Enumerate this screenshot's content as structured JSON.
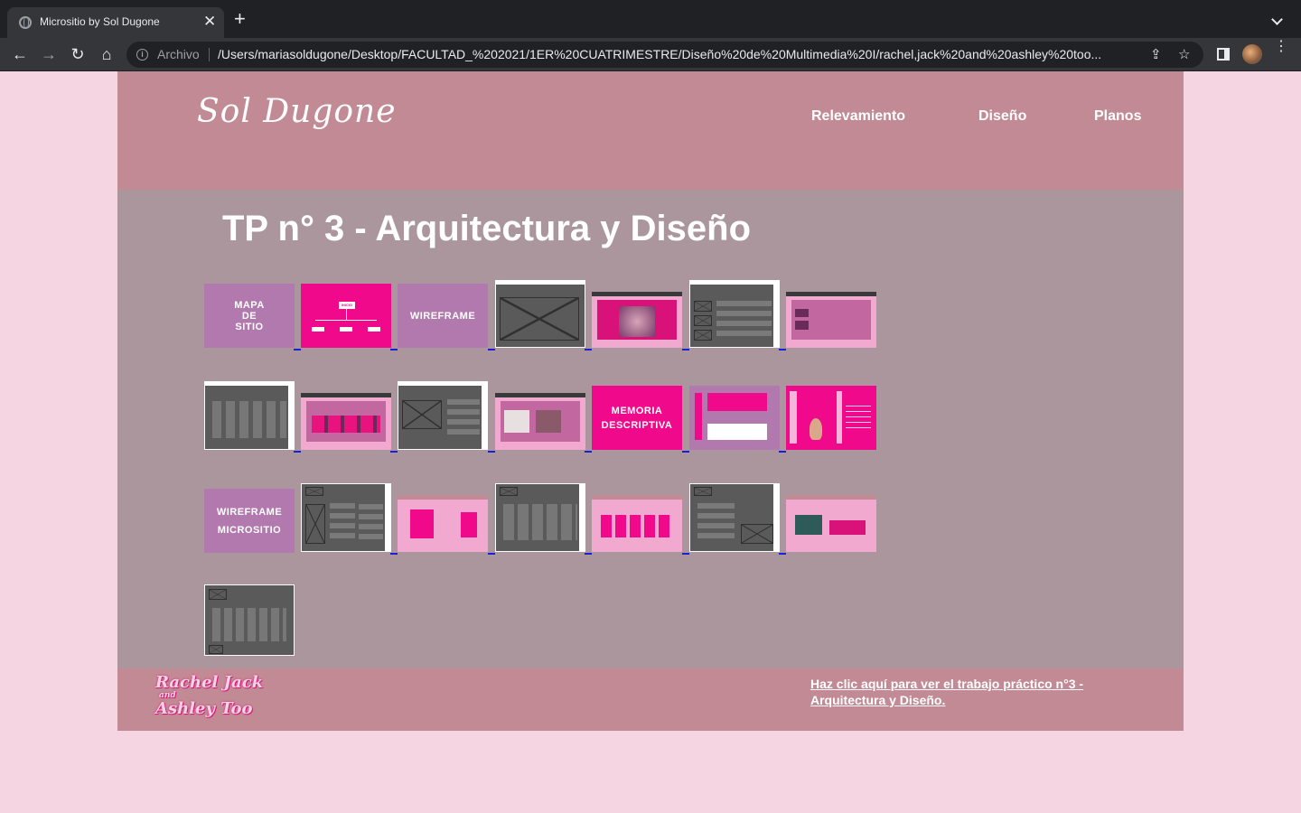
{
  "browser": {
    "tab_title": "Micrositio by Sol Dugone",
    "tab_close": "✕",
    "new_tab": "+",
    "omnibox_label": "Archivo",
    "url": "/Users/mariasoldugone/Desktop/FACULTAD_%202021/1ER%20CUATRIMESTRE/Diseño%20de%20Multimedia%20I/rachel,jack%20and%20ashley%20too..."
  },
  "header": {
    "logo": "Sol Dugone",
    "nav": [
      "Relevamiento",
      "Diseño",
      "Planos"
    ]
  },
  "main": {
    "title": "TP n° 3 - Arquitectura y Diseño",
    "cards": {
      "mapa_lines": [
        "MAPA",
        "DE",
        "SITIO"
      ],
      "inicio": "INICIO",
      "wireframe": "WIREFRAME",
      "memoria": [
        "MEMORIA",
        "DESCRIPTIVA"
      ],
      "wireframe_micro": [
        "WIREFRAME",
        "MICROSITIO"
      ]
    }
  },
  "footer": {
    "logo_lines": [
      "Rachel Jack",
      "and",
      "Ashley Too"
    ],
    "link": "Haz clic aquí para ver el trabajo práctico n°3 - Arquitectura y Diseño."
  },
  "colors": {
    "header_bg": "#c28a94",
    "content_bg": "#aa969c",
    "page_bg": "#f5d5e1",
    "accent_pink": "#f0098a",
    "card_purple": "#b179ad"
  }
}
